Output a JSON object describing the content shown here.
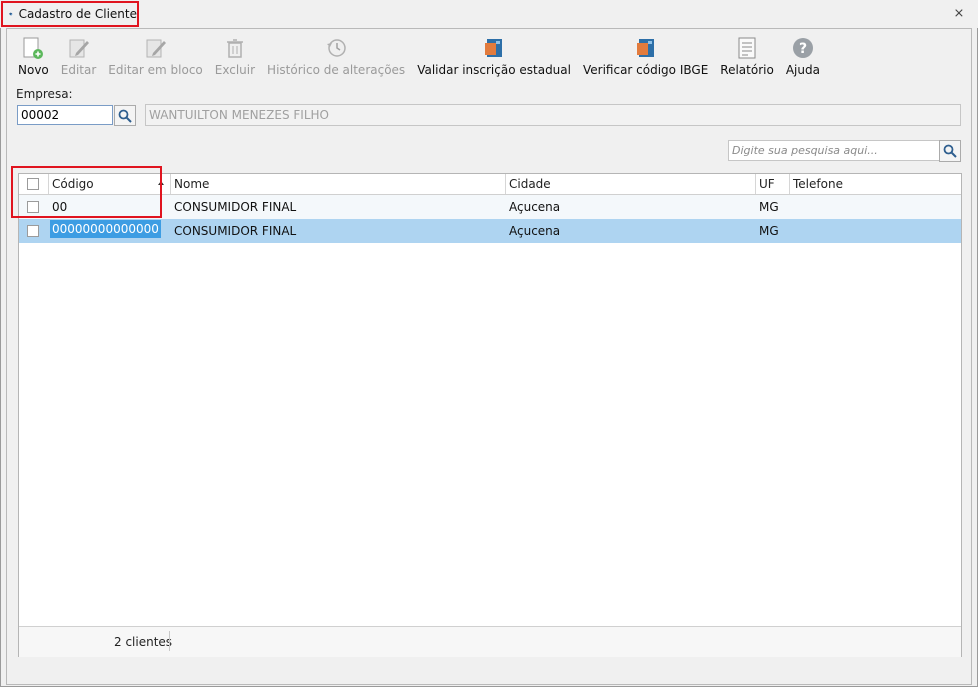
{
  "window": {
    "title": "Cadastro de Cliente",
    "close_glyph": "⨯"
  },
  "toolbar": {
    "items": [
      {
        "label": "Novo",
        "enabled": true,
        "icon": "new-document-icon"
      },
      {
        "label": "Editar",
        "enabled": false,
        "icon": "edit-icon"
      },
      {
        "label": "Editar em bloco",
        "enabled": false,
        "icon": "edit-block-icon"
      },
      {
        "label": "Excluir",
        "enabled": false,
        "icon": "trash-icon"
      },
      {
        "label": "Histórico de alterações",
        "enabled": false,
        "icon": "history-clock-icon"
      },
      {
        "label": "Validar inscrição estadual",
        "enabled": true,
        "icon": "validate-card-icon"
      },
      {
        "label": "Verificar código IBGE",
        "enabled": true,
        "icon": "verify-card-icon"
      },
      {
        "label": "Relatório",
        "enabled": true,
        "icon": "report-icon"
      },
      {
        "label": "Ajuda",
        "enabled": true,
        "icon": "help-icon"
      }
    ]
  },
  "empresa": {
    "label": "Empresa:",
    "code": "00002",
    "name": "WANTUILTON MENEZES FILHO"
  },
  "search": {
    "placeholder": "Digite sua pesquisa aqui..."
  },
  "grid": {
    "columns": [
      "Código",
      "Nome",
      "Cidade",
      "UF",
      "Telefone"
    ],
    "sorted_column": "Código",
    "rows": [
      {
        "codigo": "00",
        "nome": "CONSUMIDOR FINAL",
        "cidade": "Açucena",
        "uf": "MG",
        "telefone": ""
      },
      {
        "codigo": "00000000000000",
        "nome": "CONSUMIDOR FINAL",
        "cidade": "Açucena",
        "uf": "MG",
        "telefone": ""
      }
    ],
    "selected_row": 1,
    "footer": {
      "count": "2 clientes"
    }
  },
  "colors": {
    "highlight_border": "#e0141f",
    "selected_row": "#aed4f1",
    "selected_cell": "#3d9de3"
  }
}
